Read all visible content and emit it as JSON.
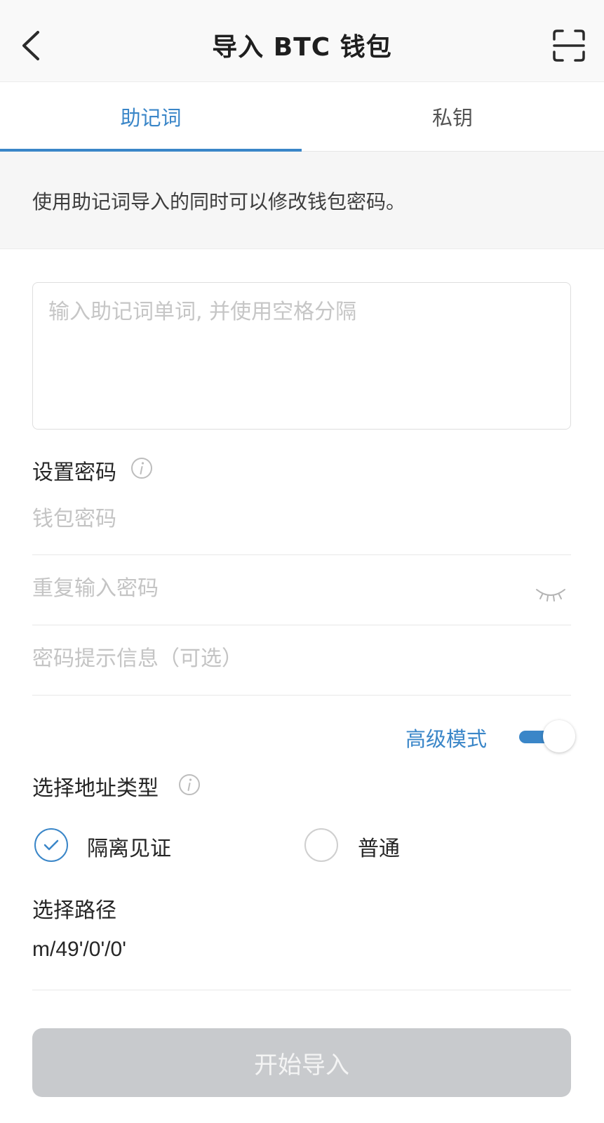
{
  "header": {
    "title": "导入 BTC 钱包",
    "back_icon": "chevron-left-icon",
    "scan_icon": "scan-icon"
  },
  "tabs": [
    {
      "label": "助记词",
      "active": true
    },
    {
      "label": "私钥",
      "active": false
    }
  ],
  "notice": "使用助记词导入的同时可以修改钱包密码。",
  "mnemonic": {
    "value": "",
    "placeholder": "输入助记词单词, 并使用空格分隔"
  },
  "password": {
    "section_label": "设置密码",
    "info_icon": "info-icon",
    "password_placeholder": "钱包密码",
    "repeat_placeholder": "重复输入密码",
    "hint_placeholder": "密码提示信息（可选）",
    "eye_icon": "eye-closed-icon"
  },
  "advanced": {
    "label": "高级模式",
    "enabled": true
  },
  "address_type": {
    "label": "选择地址类型",
    "options": [
      {
        "label": "隔离见证",
        "selected": true
      },
      {
        "label": "普通",
        "selected": false
      }
    ]
  },
  "path": {
    "label": "选择路径",
    "value": "m/49'/0'/0'"
  },
  "submit_label": "开始导入",
  "colors": {
    "accent": "#3a86c8",
    "disabled_button": "#c8cacd"
  }
}
